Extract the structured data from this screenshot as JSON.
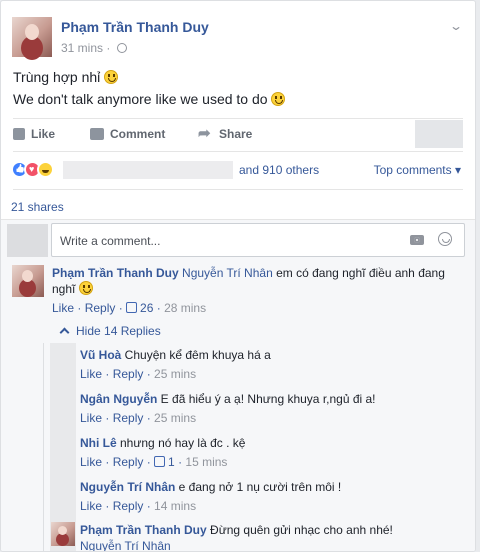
{
  "post": {
    "author": "Phạm Trần Thanh Duy",
    "time": "31 mins",
    "meta_sep": "·",
    "lines": [
      "Trùng hợp nhỉ",
      "We don't talk anymore like we used to do"
    ],
    "actions": {
      "like": "Like",
      "comment": "Comment",
      "share": "Share"
    },
    "reactions_others": "and 910 others",
    "top_comments": "Top comments ▾",
    "shares": "21 shares",
    "comment_placeholder": "Write a comment..."
  },
  "comments": [
    {
      "author": "Phạm Trần Thanh Duy",
      "tag": "Nguyễn Trí Nhân",
      "text_1": " em có đang nghĩ điều anh đang",
      "text_2": "nghĩ",
      "like": "Like",
      "reply": "Reply",
      "likes": "26",
      "time": "28 mins"
    }
  ],
  "hide_replies": "Hide 14 Replies",
  "replies": [
    {
      "author": "Vũ Hoà",
      "text": " Chuyện kể đêm khuya há a",
      "like": "Like",
      "reply": "Reply",
      "likes": "",
      "time": "25 mins"
    },
    {
      "author": "Ngân Nguyễn",
      "text": " E đã hiểu ý a ạ! Nhưng khuya r,ngủ đi a!",
      "like": "Like",
      "reply": "Reply",
      "likes": "",
      "time": "25 mins"
    },
    {
      "author": "Nhi Lê",
      "text": " nhưng nó hay là đc . kệ",
      "like": "Like",
      "reply": "Reply",
      "likes": "1",
      "time": "15 mins"
    },
    {
      "author": "Nguyễn Trí Nhân",
      "text": " e đang nở 1 nụ cười trên môi !",
      "like": "Like",
      "reply": "Reply",
      "likes": "",
      "time": "14 mins"
    },
    {
      "author": "Phạm Trần Thanh Duy",
      "text": " Đừng quên gửi nhạc cho anh nhé!",
      "tag_line": "Nguyễn Trí Nhân"
    }
  ]
}
